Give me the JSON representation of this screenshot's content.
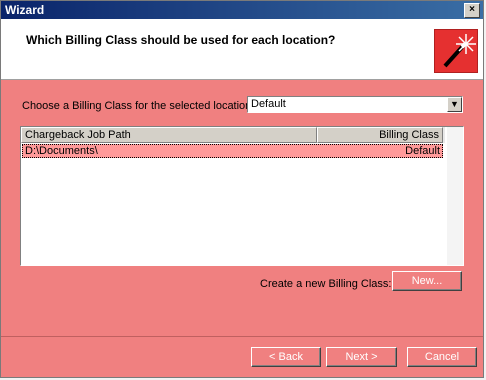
{
  "window": {
    "title": "Wizard",
    "close_glyph": "×"
  },
  "header": {
    "question": "Which Billing Class should be used for each location?",
    "icon": "magic-wand-icon"
  },
  "main": {
    "choose_label": "Choose a Billing Class for the selected location:",
    "select_value": "Default",
    "columns": [
      "Chargeback Job Path",
      "Billing Class"
    ],
    "rows": [
      {
        "path": "D:\\Documents\\",
        "class": "Default"
      }
    ],
    "new_label": "Create a new Billing Class:",
    "new_button": "New..."
  },
  "footer": {
    "back": "< Back",
    "next": "Next >",
    "cancel": "Cancel"
  },
  "colors": {
    "accent": "#f08080",
    "title_bar": "#0a246a",
    "selected_row": "#ff9a9a"
  }
}
